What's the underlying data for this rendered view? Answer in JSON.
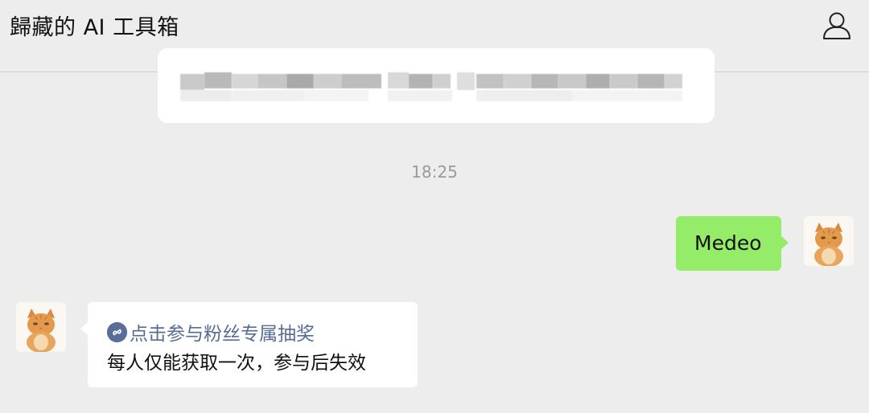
{
  "header": {
    "title": "歸藏的 AI 工具箱",
    "profile_icon": "person-outline-icon"
  },
  "chat": {
    "timestamp": "18:25",
    "messages": [
      {
        "direction": "sent",
        "text": "Medeo",
        "bubble_color": "#95ec69"
      },
      {
        "direction": "received",
        "link_text": "点击参与粉丝专属抽奖",
        "link_icon": "mini-program-link-icon",
        "text": "每人仅能获取一次，参与后失效",
        "link_color": "#576b95"
      }
    ]
  },
  "colors": {
    "background": "#ededed",
    "bubble_sent": "#95ec69",
    "bubble_received": "#ffffff",
    "timestamp": "#9a9a9a"
  }
}
